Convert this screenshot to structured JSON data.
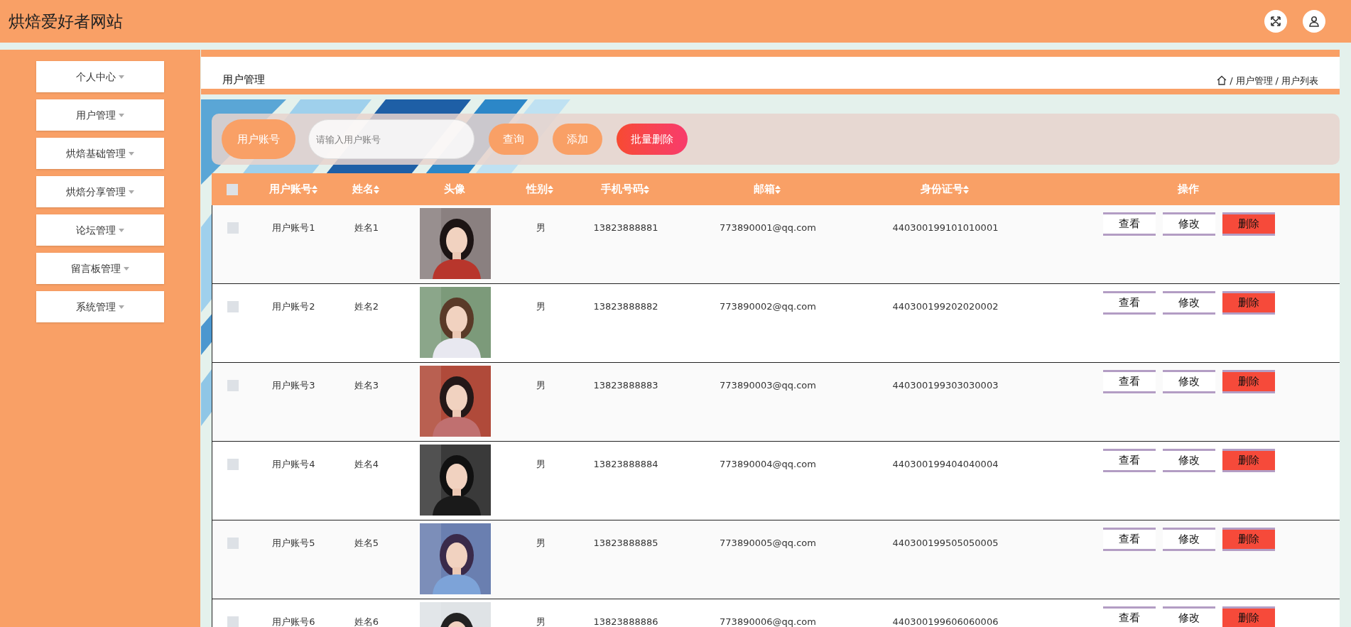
{
  "site_title": "烘焙爱好者网站",
  "sidebar": {
    "items": [
      {
        "label": "个人中心",
        "expanded": false
      },
      {
        "label": "用户管理",
        "expanded": false
      },
      {
        "label": "烘焙基础管理",
        "expanded": false
      },
      {
        "label": "烘焙分享管理",
        "expanded": false
      },
      {
        "label": "论坛管理",
        "expanded": false
      },
      {
        "label": "留言板管理",
        "expanded": false
      },
      {
        "label": "系统管理",
        "expanded": false
      }
    ]
  },
  "page_title": "用户管理",
  "breadcrumb": [
    {
      "separator": "/",
      "label": "用户管理"
    },
    {
      "separator": "/",
      "label": "用户列表"
    }
  ],
  "search": {
    "label": "用户账号",
    "placeholder": "请输入用户账号",
    "buttons": [
      {
        "label": "查询",
        "kind": "primary"
      },
      {
        "label": "添加",
        "kind": "primary"
      },
      {
        "label": "批量删除",
        "kind": "danger"
      }
    ]
  },
  "table": {
    "select_all": {
      "checked": false
    },
    "columns": [
      {
        "label": "用户账号",
        "sortable": true
      },
      {
        "label": "姓名",
        "sortable": true
      },
      {
        "label": "头像",
        "sortable": false
      },
      {
        "label": "性别",
        "sortable": true
      },
      {
        "label": "手机号码",
        "sortable": true
      },
      {
        "label": "邮箱",
        "sortable": true
      },
      {
        "label": "身份证号",
        "sortable": true
      },
      {
        "label": "操作",
        "sortable": false
      }
    ],
    "rows": [
      {
        "checked": false,
        "account": "用户账号1",
        "name": "姓名1",
        "gender": "男",
        "phone": "13823888881",
        "email": "773890001@qq.com",
        "id_number": "440300199101010001",
        "actions": [
          {
            "label": "查看",
            "kind": "view"
          },
          {
            "label": "修改",
            "kind": "edit"
          },
          {
            "label": "删除",
            "kind": "delete"
          }
        ]
      },
      {
        "checked": false,
        "account": "用户账号2",
        "name": "姓名2",
        "gender": "男",
        "phone": "13823888882",
        "email": "773890002@qq.com",
        "id_number": "440300199202020002",
        "actions": [
          {
            "label": "查看",
            "kind": "view"
          },
          {
            "label": "修改",
            "kind": "edit"
          },
          {
            "label": "删除",
            "kind": "delete"
          }
        ]
      },
      {
        "checked": false,
        "account": "用户账号3",
        "name": "姓名3",
        "gender": "男",
        "phone": "13823888883",
        "email": "773890003@qq.com",
        "id_number": "440300199303030003",
        "actions": [
          {
            "label": "查看",
            "kind": "view"
          },
          {
            "label": "修改",
            "kind": "edit"
          },
          {
            "label": "删除",
            "kind": "delete"
          }
        ]
      },
      {
        "checked": false,
        "account": "用户账号4",
        "name": "姓名4",
        "gender": "男",
        "phone": "13823888884",
        "email": "773890004@qq.com",
        "id_number": "440300199404040004",
        "actions": [
          {
            "label": "查看",
            "kind": "view"
          },
          {
            "label": "修改",
            "kind": "edit"
          },
          {
            "label": "删除",
            "kind": "delete"
          }
        ]
      },
      {
        "checked": false,
        "account": "用户账号5",
        "name": "姓名5",
        "gender": "男",
        "phone": "13823888885",
        "email": "773890005@qq.com",
        "id_number": "440300199505050005",
        "actions": [
          {
            "label": "查看",
            "kind": "view"
          },
          {
            "label": "修改",
            "kind": "edit"
          },
          {
            "label": "删除",
            "kind": "delete"
          }
        ]
      },
      {
        "checked": false,
        "account": "用户账号6",
        "name": "姓名6",
        "gender": "男",
        "phone": "13823888886",
        "email": "773890006@qq.com",
        "id_number": "440300199606060006",
        "actions": [
          {
            "label": "查看",
            "kind": "view"
          },
          {
            "label": "修改",
            "kind": "edit"
          },
          {
            "label": "删除",
            "kind": "delete"
          }
        ]
      }
    ]
  }
}
